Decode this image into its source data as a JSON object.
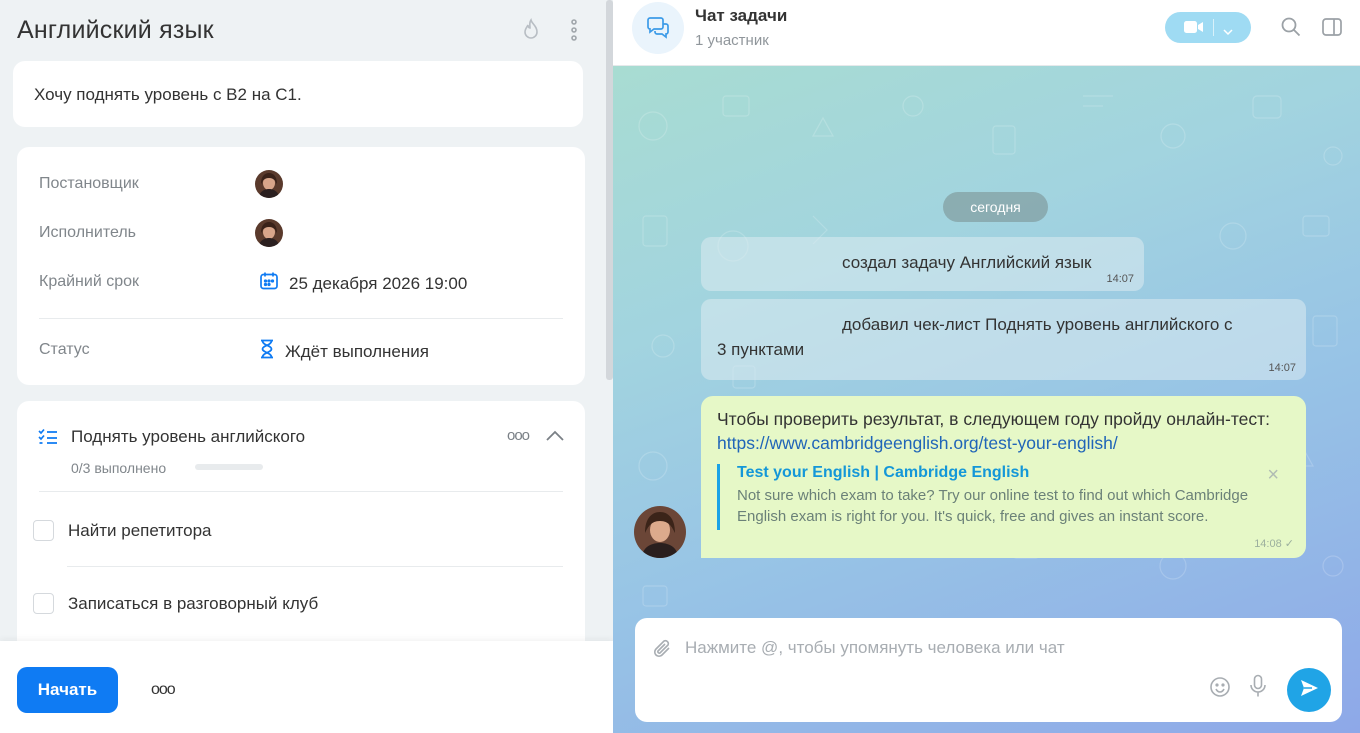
{
  "task": {
    "title": "Английский язык",
    "description": "Хочу поднять уровень с B2 на C1.",
    "fields": {
      "creator_label": "Постановщик",
      "assignee_label": "Исполнитель",
      "deadline_label": "Крайний срок",
      "deadline_value": "25 декабря 2026 19:00",
      "status_label": "Статус",
      "status_value": "Ждёт выполнения"
    },
    "checklist": {
      "title": "Поднять уровень английского",
      "progress": "0/3 выполнено",
      "progress_fraction": 0,
      "items": [
        {
          "label": "Найти репетитора",
          "checked": false
        },
        {
          "label": "Записаться в разговорный клуб",
          "checked": false
        }
      ]
    },
    "footer": {
      "start_label": "Начать",
      "more_label": "ooo"
    }
  },
  "chat": {
    "title": "Чат задачи",
    "subtitle": "1 участник",
    "date_pill": "сегодня",
    "system_messages": [
      {
        "text": "создал задачу Английский язык",
        "time": "14:07"
      },
      {
        "text_line1": "добавил чек-лист Поднять уровень английского с",
        "text_line2": "3 пунктами",
        "time": "14:07"
      }
    ],
    "message": {
      "text": "Чтобы проверить результат, в следующем году пройду онлайн-тест: ",
      "link": "https://www.cambridgeenglish.org/test-your-english/",
      "preview_title": "Test your English | Cambridge English",
      "preview_desc": "Not sure which exam to take? Try our online test to find out which Cambridge English exam is right for you. It's quick, free and gives an instant score.",
      "time": "14:08"
    },
    "composer_placeholder": "Нажмите @, чтобы упомянуть человека или чат"
  },
  "colors": {
    "accent": "#0f7bf3",
    "message_bubble": "#e6f8c7",
    "link": "#2065b8",
    "send_button": "#20a4e6"
  }
}
